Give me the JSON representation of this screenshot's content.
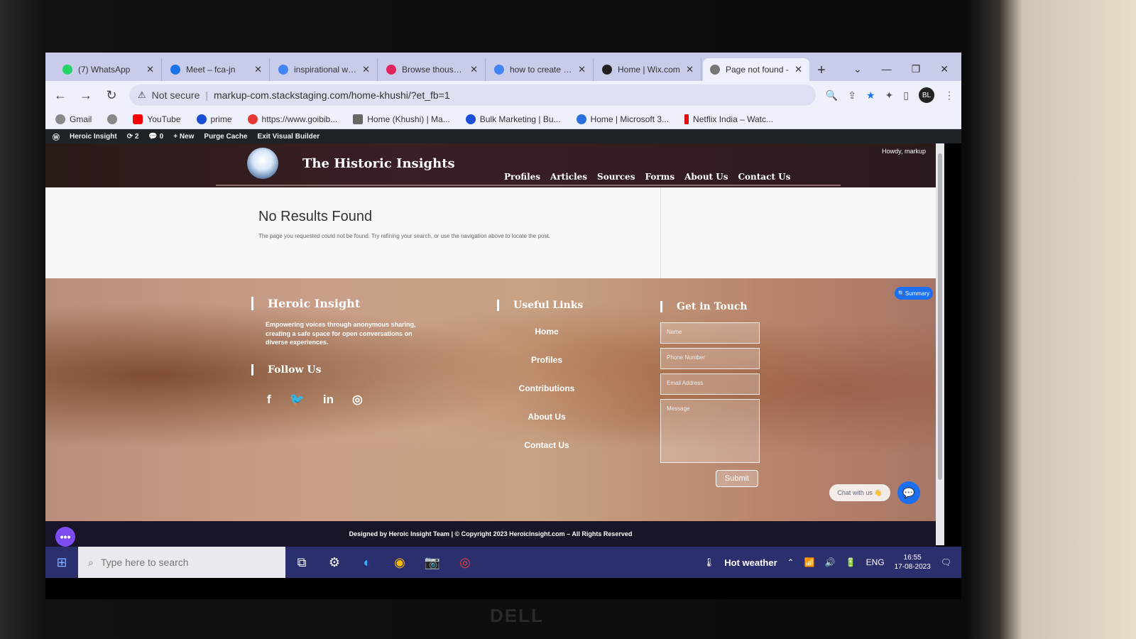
{
  "browser": {
    "tabs": [
      {
        "label": "(7) WhatsApp",
        "color": "#25d366"
      },
      {
        "label": "Meet – fca-jn",
        "color": "#1a73e8"
      },
      {
        "label": "inspirational wwe",
        "color": "#4285f4"
      },
      {
        "label": "Browse thousand",
        "color": "#e0245e"
      },
      {
        "label": "how to create a c",
        "color": "#4285f4"
      },
      {
        "label": "Home | Wix.com",
        "color": "#222222"
      },
      {
        "label": "Page not found -",
        "color": "#777777"
      }
    ],
    "url_warning": "Not secure",
    "url": "markup-com.stackstaging.com/home-khushi/?et_fb=1",
    "bookmarks": [
      "Gmail",
      "YouTube",
      "prime",
      "https://www.goibib...",
      "Home (Khushi) | Ma...",
      "Bulk Marketing | Bu...",
      "Home | Microsoft 3...",
      "Netflix India – Watc..."
    ],
    "profile_initials": "BL"
  },
  "wp_admin": {
    "site": "Heroic Insight",
    "updates": "2",
    "comments": "0",
    "new": "New",
    "purge": "Purge Cache",
    "exit_builder": "Exit Visual Builder",
    "howdy": "Howdy, markup"
  },
  "site": {
    "brand": "The Historic Insights",
    "nav": [
      "Profiles",
      "Articles",
      "Sources",
      "Forms",
      "About Us",
      "Contact Us"
    ],
    "title": "No Results Found",
    "description": "The page you requested could not be found. Try refining your search, or use the navigation above to locate the post.",
    "footer": {
      "about_title": "Heroic Insight",
      "about_text": "Empowering voices through anonymous sharing, creating a safe space for open conversations on diverse experiences.",
      "follow_title": "Follow Us",
      "social": [
        "f",
        "🐦",
        "in",
        "◎"
      ],
      "links_title": "Useful Links",
      "links": [
        "Home",
        "Profiles",
        "Contributions",
        "About Us",
        "Contact Us"
      ],
      "contact_title": "Get in Touch",
      "placeholders": {
        "name": "Name",
        "phone": "Phone Number",
        "email": "Email Address",
        "message": "Message"
      },
      "submit": "Submit",
      "chat": "Chat with us 👋",
      "summary": "Summary",
      "copyright": "Designed by Heroic Insight Team | © Copyright 2023 HeroicInsight.com – All Rights Reserved"
    }
  },
  "taskbar": {
    "search_placeholder": "Type here to search",
    "weather": "Hot weather",
    "lang": "ENG",
    "time": "16:55",
    "date": "17-08-2023"
  },
  "device": {
    "logo": "DELL"
  }
}
